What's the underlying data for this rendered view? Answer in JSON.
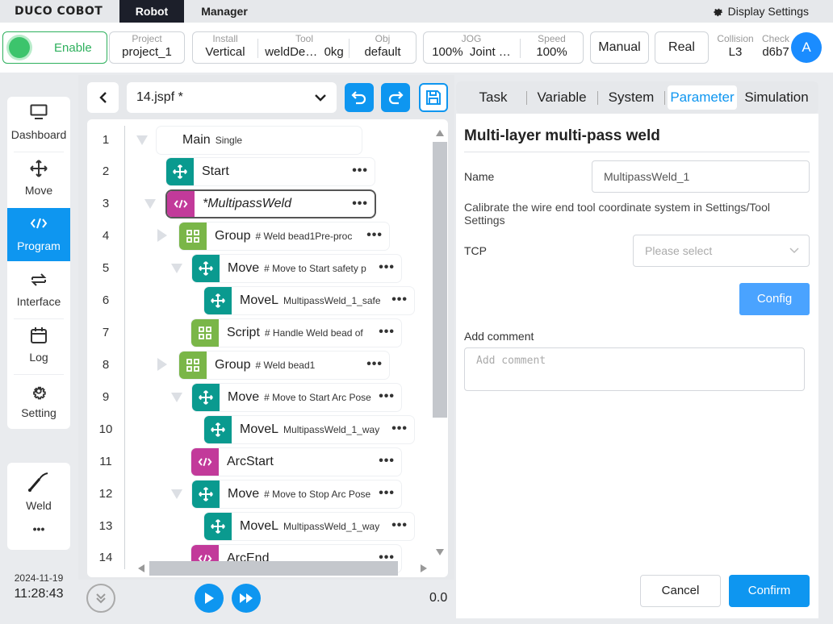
{
  "topbar": {
    "brand": "DUCO COBOT",
    "tabs": [
      {
        "label": "Robot"
      },
      {
        "label": "Manager"
      }
    ],
    "display_settings": "Display Settings"
  },
  "status": {
    "enable_label": "Enable",
    "project": {
      "key": "Project",
      "value": "project_1"
    },
    "install": {
      "key": "Install",
      "value": "Vertical"
    },
    "tool": {
      "key": "Tool",
      "value": "weldDe…",
      "extra": "0kg"
    },
    "obj": {
      "key": "Obj",
      "value": "default"
    },
    "jog": {
      "key": "JOG",
      "value": "100%",
      "extra": "Joint …"
    },
    "speed": {
      "key": "Speed",
      "value": "100%"
    },
    "mode_manual": "Manual",
    "mode_real": "Real",
    "collision": {
      "key": "Collision",
      "value": "L3"
    },
    "check": {
      "key": "Check",
      "value": "d6b7"
    },
    "avatar": "A"
  },
  "sidebar": {
    "items": [
      {
        "label": "Dashboard",
        "icon": "monitor-icon"
      },
      {
        "label": "Move",
        "icon": "move-arrows-icon"
      },
      {
        "label": "Program",
        "icon": "code-icon",
        "active": true
      },
      {
        "label": "Interface",
        "icon": "swap-arrows-icon"
      },
      {
        "label": "Log",
        "icon": "calendar-icon"
      },
      {
        "label": "Setting",
        "icon": "gear-icon"
      }
    ],
    "weld_label": "Weld",
    "more": "•••",
    "date": "2024-11-19",
    "time": "11:28:43"
  },
  "program": {
    "file_name": "14.jspf *",
    "line_numbers": [
      "1",
      "2",
      "3",
      "4",
      "5",
      "6",
      "7",
      "8",
      "9",
      "10",
      "11",
      "12",
      "13",
      "14"
    ],
    "nodes": [
      {
        "name": "Main",
        "comment": "Single"
      },
      {
        "name": "Start",
        "comment": ""
      },
      {
        "name": "*MultipassWeld",
        "comment": ""
      },
      {
        "name": "Group",
        "comment": "# Weld bead1Pre-proc"
      },
      {
        "name": "Move",
        "comment": "# Move to Start safety p"
      },
      {
        "name": "MoveL",
        "comment": "MultipassWeld_1_safe"
      },
      {
        "name": "Script",
        "comment": "# Handle Weld bead of"
      },
      {
        "name": "Group",
        "comment": "# Weld bead1"
      },
      {
        "name": "Move",
        "comment": "# Move to Start Arc Pose"
      },
      {
        "name": "MoveL",
        "comment": "MultipassWeld_1_way"
      },
      {
        "name": "ArcStart",
        "comment": ""
      },
      {
        "name": "Move",
        "comment": "# Move to Stop Arc Pose"
      },
      {
        "name": "MoveL",
        "comment": "MultipassWeld_1_way"
      },
      {
        "name": "ArcEnd",
        "comment": ""
      }
    ],
    "speed_value": "0.0"
  },
  "right_tabs": [
    "Task",
    "Variable",
    "System",
    "Parameter",
    "Simulation"
  ],
  "params": {
    "title": "Multi-layer multi-pass weld",
    "name_label": "Name",
    "name_value": "MultipassWeld_1",
    "description": "Calibrate the wire end tool coordinate system in Settings/Tool Settings",
    "tcp_label": "TCP",
    "tcp_placeholder": "Please select",
    "config_label": "Config",
    "comment_label": "Add comment",
    "comment_placeholder": "Add comment",
    "cancel_label": "Cancel",
    "confirm_label": "Confirm"
  },
  "colors": {
    "accent": "#0e96f0",
    "enable": "#2eb05d",
    "move": "#0a9a8f",
    "group": "#7ab648",
    "script": "#c23a9a"
  }
}
